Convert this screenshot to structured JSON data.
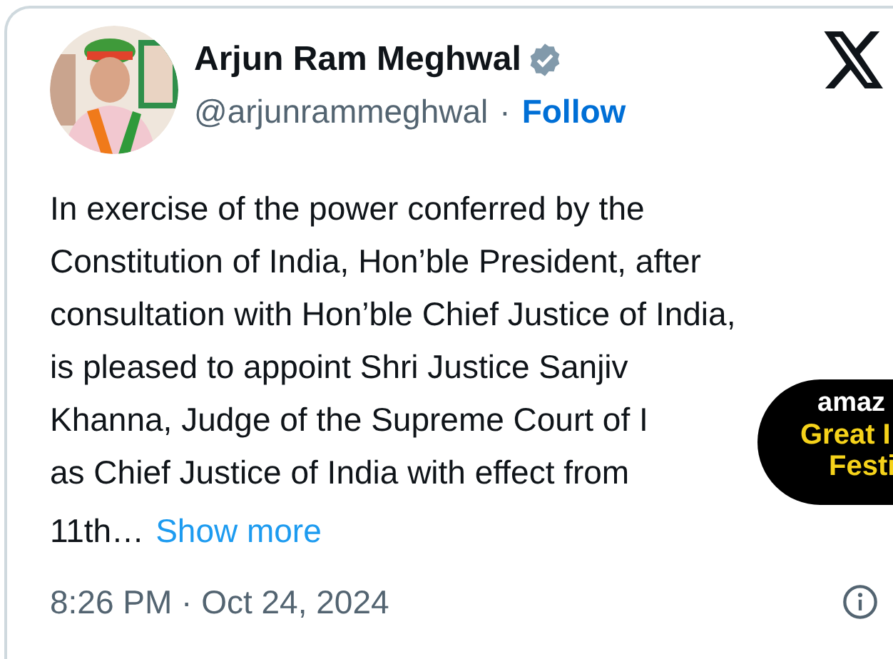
{
  "author": {
    "name": "Arjun Ram Meghwal",
    "verified": true,
    "handle": "@arjunrammeghwal",
    "separator": "·",
    "follow": "Follow"
  },
  "body": {
    "lines": [
      "In exercise of the power conferred by the",
      "Constitution of India, Hon’ble President, after",
      "consultation with Hon’ble Chief Justice of India,",
      "is pleased to appoint Shri Justice Sanjiv",
      "Khanna, Judge of the Supreme Court of I",
      "as Chief Justice of India with effect from",
      "11th…"
    ],
    "show_more": "Show more"
  },
  "ad": {
    "brand": "amaz",
    "lines": [
      "Great I",
      "Festi"
    ]
  },
  "footer": {
    "timestamp": "8:26 PM · Oct 24, 2024"
  }
}
